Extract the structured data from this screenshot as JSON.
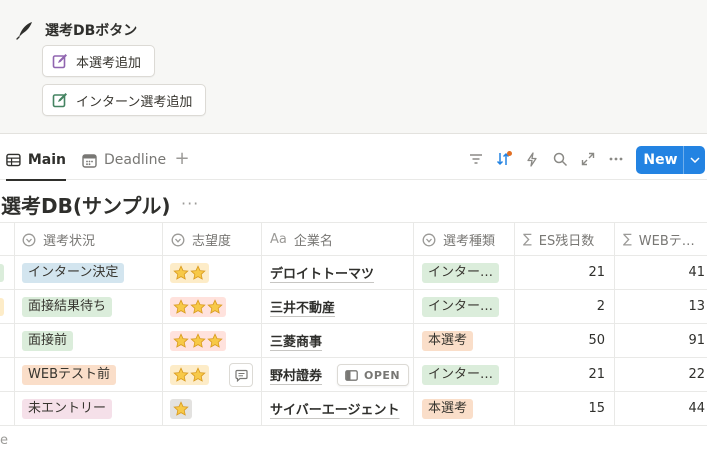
{
  "button_panel": {
    "title": "選考DBボタン",
    "buttons": [
      {
        "label": "本選考追加"
      },
      {
        "label": "インターン選考追加"
      }
    ]
  },
  "tabs": [
    {
      "label": "Main",
      "icon": "table-icon",
      "active": true
    },
    {
      "label": "Deadline",
      "icon": "calendar-icon",
      "active": false
    }
  ],
  "toolbar": {
    "icons": [
      "filter-icon",
      "sort-icon",
      "lightning-icon",
      "search-icon",
      "expand-icon",
      "more-icon"
    ],
    "new_label": "New"
  },
  "database": {
    "title": "選考DB(サンプル)",
    "more": "···",
    "columns": [
      {
        "label": "選考状況",
        "icon": "status-icon"
      },
      {
        "label": "志望度",
        "icon": "status-icon"
      },
      {
        "label": "企業名",
        "icon": "text-icon",
        "prefix": "Aa"
      },
      {
        "label": "選考種類",
        "icon": "status-icon"
      },
      {
        "label": "ES残日数",
        "icon": "formula-icon",
        "prefix": "∑"
      },
      {
        "label": "WEBテ…",
        "icon": "formula-icon",
        "prefix": "∑"
      }
    ],
    "rows": [
      {
        "status": "インターン決定",
        "status_color": "blue",
        "stars": 2,
        "stars_color": "yellow",
        "company": "デロイトトーマツ",
        "type": "インター…",
        "type_color": "green",
        "es_days": "21",
        "web": "41",
        "sliver": "#dbeddb"
      },
      {
        "status": "面接結果待ち",
        "status_color": "green",
        "stars": 3,
        "stars_color": "red",
        "company": "三井不動産",
        "type": "インター…",
        "type_color": "green",
        "es_days": "2",
        "web": "13",
        "sliver": "#fdecc8"
      },
      {
        "status": "面接前",
        "status_color": "green",
        "stars": 3,
        "stars_color": "red",
        "company": "三菱商事",
        "type": "本選考",
        "type_color": "orange",
        "es_days": "50",
        "web": "91",
        "sliver": ""
      },
      {
        "status": "WEBテスト前",
        "status_color": "orange",
        "stars": 2,
        "stars_color": "yellow",
        "company": "野村證券",
        "type": "インター…",
        "type_color": "green",
        "es_days": "21",
        "web": "22",
        "sliver": ""
      },
      {
        "status": "未エントリー",
        "status_color": "pink",
        "stars": 1,
        "stars_color": "gray",
        "company": "サイバーエージェント",
        "type": "本選考",
        "type_color": "orange",
        "es_days": "15",
        "web": "44",
        "sliver": ""
      }
    ],
    "open_label": "OPEN",
    "footer_fragment": "e"
  },
  "colors": {
    "accent": "#2383e2",
    "sort_dot": "#e16f24",
    "star": "#f7c948"
  }
}
